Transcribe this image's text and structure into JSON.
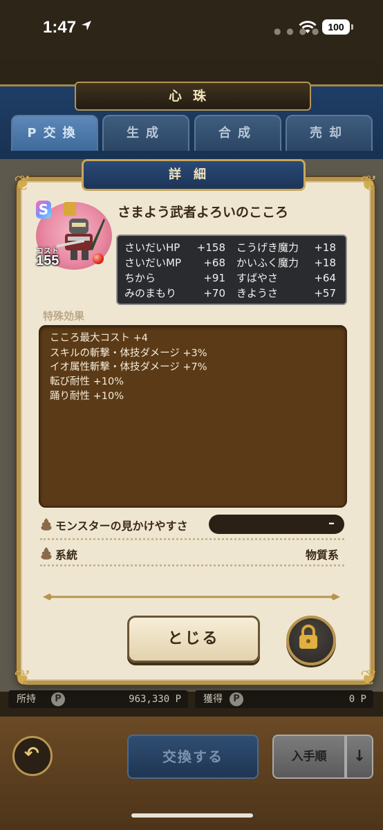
{
  "status_bar": {
    "time": "1:47",
    "battery": "100"
  },
  "background": {
    "screen_title": "心珠",
    "tabs": [
      "P交換",
      "生成",
      "合成",
      "売却"
    ],
    "owned_label": "所持",
    "owned_value": "963,330 P",
    "earned_label": "獲得",
    "earned_value": "0 P",
    "coin_symbol": "P",
    "exchange_button": "交換する",
    "sort_button": "入手順",
    "sort_direction": "↓"
  },
  "modal": {
    "title": "詳細",
    "rank": "S",
    "cost_label": "コスト",
    "cost_value": "155",
    "orb_name": "さまよう武者よろいのこころ",
    "stats": [
      {
        "label": "さいだいHP",
        "value": "+158"
      },
      {
        "label": "こうげき魔力",
        "value": "+18"
      },
      {
        "label": "さいだいMP",
        "value": "+68"
      },
      {
        "label": "かいふく魔力",
        "value": "+18"
      },
      {
        "label": "ちから",
        "value": "+91"
      },
      {
        "label": "すばやさ",
        "value": "+64"
      },
      {
        "label": "みのまもり",
        "value": "+70"
      },
      {
        "label": "きようさ",
        "value": "+57"
      }
    ],
    "special_effects_title": "特殊効果",
    "special_effects": [
      "こころ最大コスト +4",
      "スキルの斬撃・体技ダメージ +3%",
      "イオ属性斬撃・体技ダメージ +7%",
      "転び耐性 +10%",
      "踊り耐性 +10%"
    ],
    "visibility_label": "モンスターの見かけやすさ",
    "visibility_value": "–",
    "lineage_label": "系統",
    "lineage_value": "物質系",
    "close_button": "とじる"
  },
  "colors": {
    "modal_bg": "#efe6d2",
    "gold_border": "#b8954f",
    "effects_bg": "#5b3a17",
    "stats_bg": "#2a2b2e"
  },
  "icons": [
    "location-arrow-icon",
    "wifi-icon",
    "lock-icon",
    "back-arrow-icon",
    "poo-icon",
    "red-orb-icon"
  ]
}
